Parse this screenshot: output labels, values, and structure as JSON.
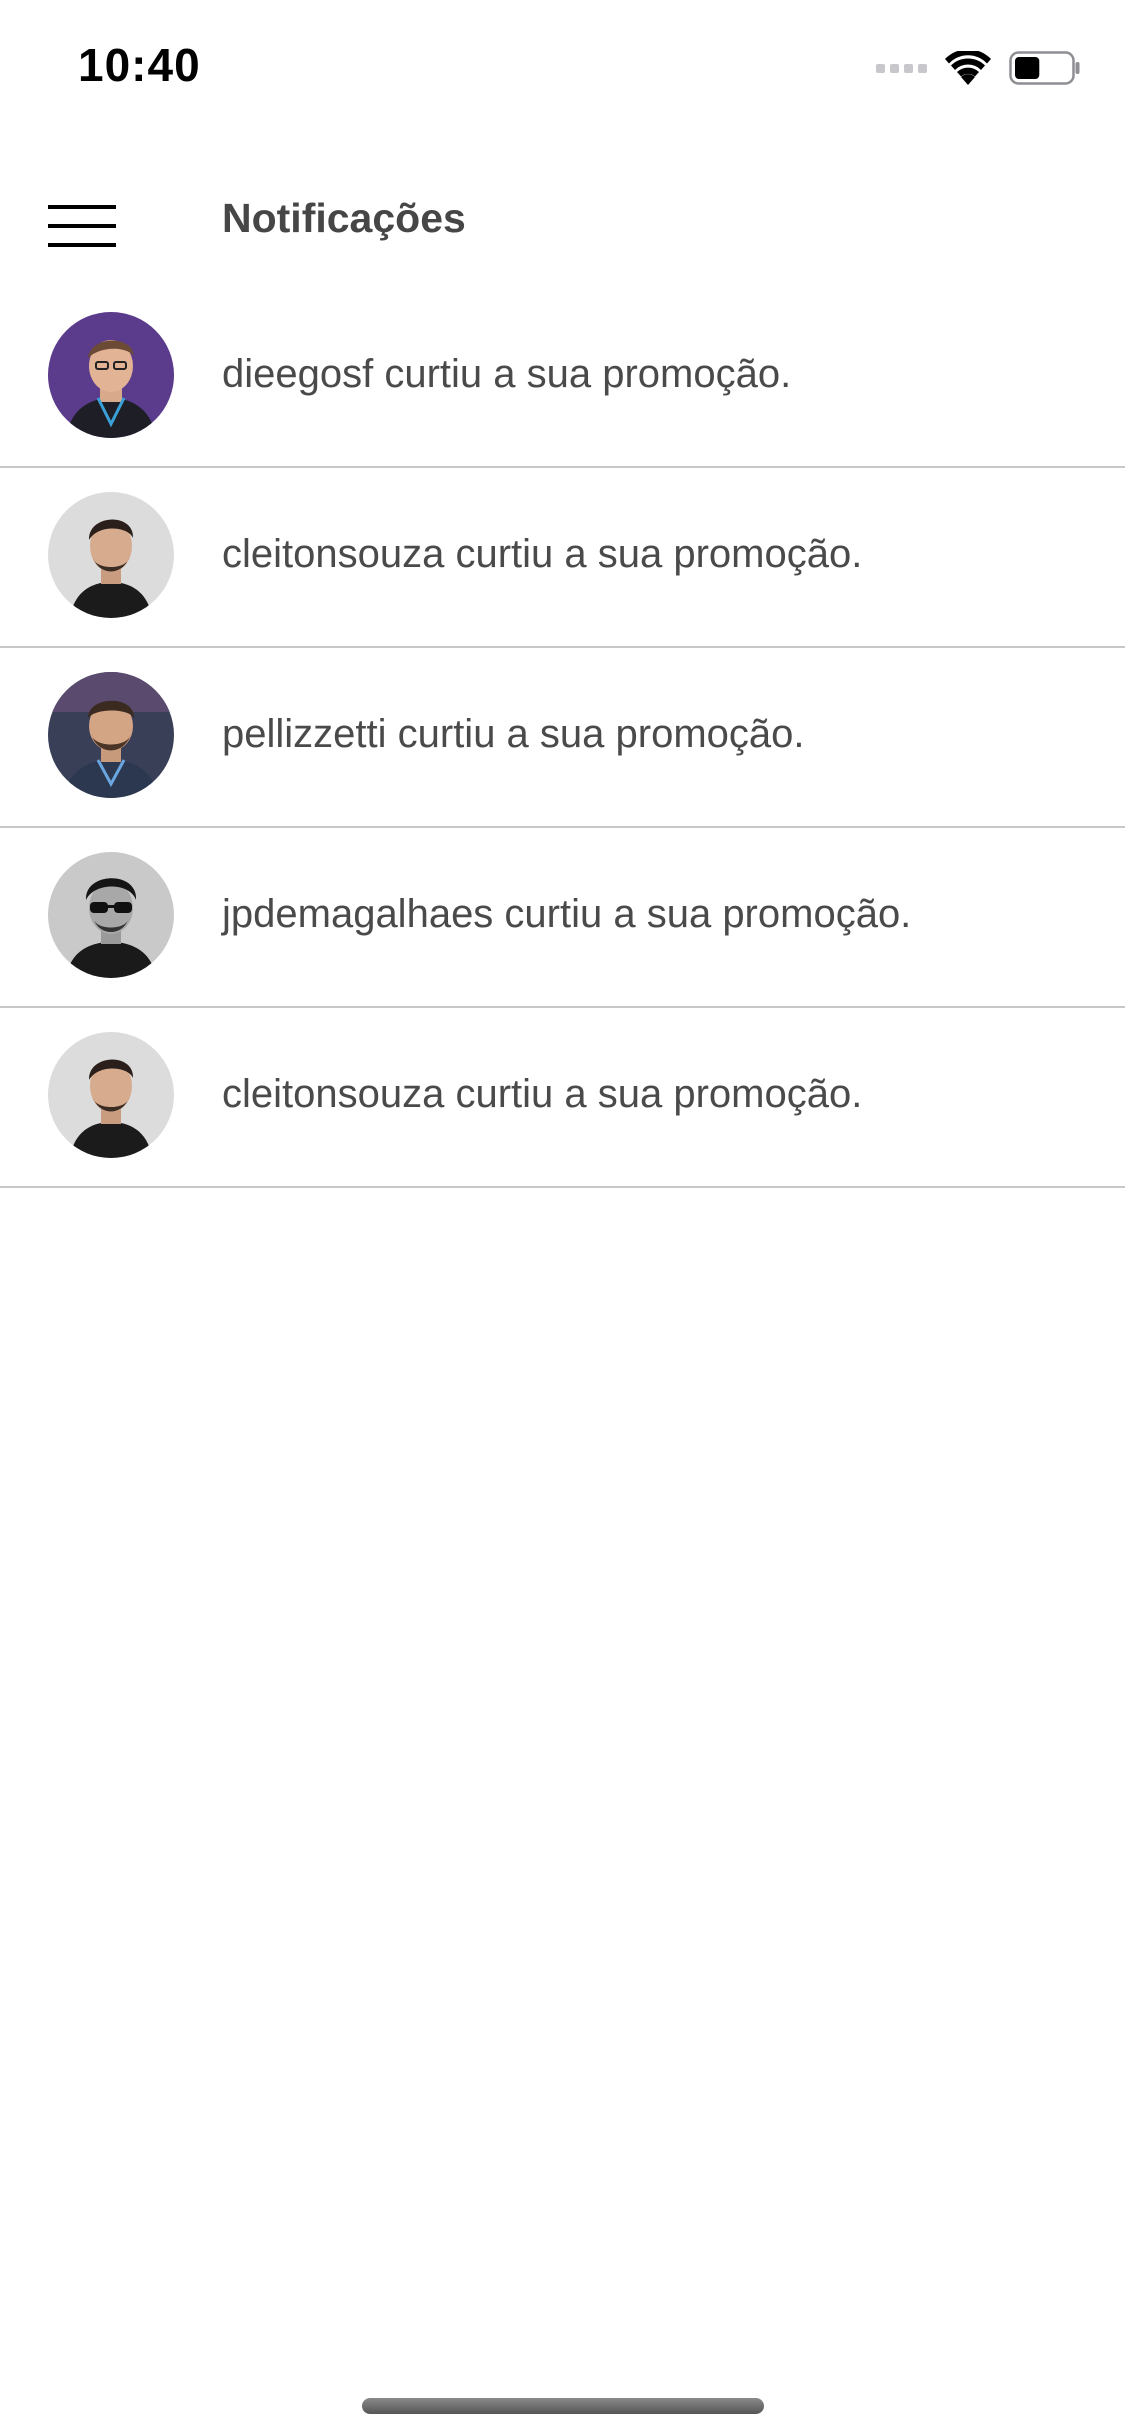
{
  "status_bar": {
    "time": "10:40",
    "signal_icon": "cellular-signal-icon",
    "wifi_icon": "wifi-icon",
    "battery_icon": "battery-icon",
    "battery_level": 0.45
  },
  "header": {
    "menu_icon": "hamburger-menu-icon",
    "title": "Notificações"
  },
  "notifications": [
    {
      "user": "dieegosf",
      "text": "dieegosf curtiu a sua promoção.",
      "avatar_bg": "#5b3b8c"
    },
    {
      "user": "cleitonsouza",
      "text": "cleitonsouza curtiu a sua promoção.",
      "avatar_bg": "#dcdcdc"
    },
    {
      "user": "pellizzetti",
      "text": "pellizzetti curtiu a sua promoção.",
      "avatar_bg": "#3a3f58"
    },
    {
      "user": "jpdemagalhaes",
      "text": "jpdemagalhaes curtiu a sua promoção.",
      "avatar_bg": "#c9c9c9"
    },
    {
      "user": "cleitonsouza",
      "text": "cleitonsouza curtiu a sua promoção.",
      "avatar_bg": "#dcdcdc"
    }
  ],
  "colors": {
    "text": "#4a4a4a",
    "title": "#464646",
    "divider": "#c8c8c8",
    "background": "#ffffff"
  }
}
